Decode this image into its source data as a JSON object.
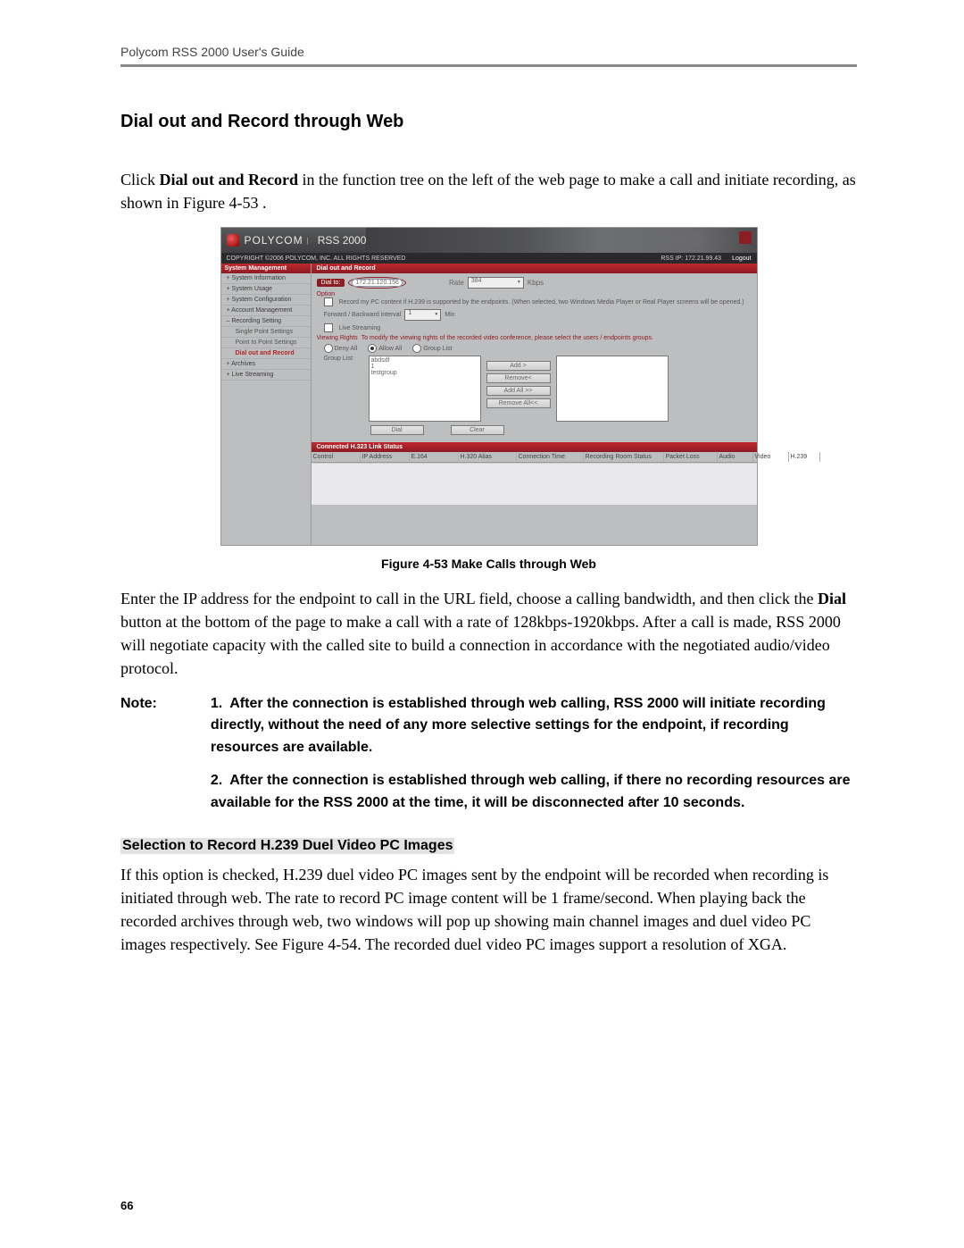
{
  "doc": {
    "running_head": "Polycom RSS 2000 User's Guide",
    "page_number": "66",
    "section_title": "Dial out and Record through Web",
    "intro_prefix": "Click ",
    "intro_bold": "Dial out and Record",
    "intro_suffix": " in the function tree on the left of the web page to make a call and initiate recording, as shown in Figure 4-53 .",
    "figure_caption": "Figure 4-53 Make Calls through Web",
    "para2_a": "Enter the IP address for the endpoint to call in the URL field, choose a calling bandwidth, and then click the ",
    "para2_bold": "Dial",
    "para2_b": " button at the bottom of the page to make a call with a rate of 128kbps-1920kbps. After a call is made, RSS 2000 will negotiate capacity with the called site to build a connection in accordance with the negotiated audio/video protocol.",
    "note_label": "Note:",
    "note1": "After the connection is established through web calling, RSS 2000 will initiate recording directly, without the need of any more selective settings for the endpoint, if recording resources are available.",
    "note2": "After the connection is established through web calling, if there no recording resources are available for the RSS 2000 at the time, it will be disconnected after 10 seconds.",
    "subsection": "Selection to Record H.239 Duel Video PC Images",
    "para3": "If this option is checked, H.239 duel video PC images sent by the endpoint will be recorded when recording is initiated through web. The rate to record PC image content will be 1 frame/second. When playing back the recorded archives through web, two windows will pop up showing main channel images and duel video PC images respectively. See Figure 4-54. The recorded duel video PC images support a resolution of XGA."
  },
  "app": {
    "brand_a": "POLYCOM",
    "brand_b": "RSS 2000",
    "copyright": "COPYRIGHT ©2006 POLYCOM, INC. ALL RIGHTS RESERVED",
    "rss_ip_label": "RSS IP: 172.21.99.43",
    "logout": "Logout",
    "sidebar_header": "System Management",
    "sidebar_items": [
      {
        "label": "System Information",
        "type": "expand"
      },
      {
        "label": "System Usage",
        "type": "expand"
      },
      {
        "label": "System Configuration",
        "type": "expand"
      },
      {
        "label": "Account Management",
        "type": "expand"
      },
      {
        "label": "Recording Setting",
        "type": "collapse"
      },
      {
        "label": "Single Point Settings",
        "type": "sub"
      },
      {
        "label": "Point to Point Settings",
        "type": "sub"
      },
      {
        "label": "Dial out and Record",
        "type": "sub-active"
      },
      {
        "label": "Archives",
        "type": "expand"
      },
      {
        "label": "Live Streaming",
        "type": "expand"
      }
    ],
    "content_header": "Dial out and Record",
    "dial_to_label": "Dial to:",
    "dial_to_value": "172.21.120.156",
    "rate_label": "Rate",
    "rate_value": "384",
    "rate_unit": "Kbps",
    "option_label": "Option",
    "record_pc_text": "Record my PC content if H.239 is supported by the endpoints. (When selected, two Windows Media Player or Real Player screens will be opened.)",
    "fwd_back_label": "Forward / Backward interval",
    "fwd_back_value": "1",
    "fwd_back_unit": "Min",
    "live_streaming_label": "Live Streaming",
    "viewing_rights_label": "Viewing Rights",
    "viewing_rights_hint": "To modify the viewing rights of the recorded video conference, please select the users / endpoints groups.",
    "radio_deny": "Deny All",
    "radio_allow": "Allow All",
    "radio_group": "Group List",
    "group_list_label": "Group List:",
    "group_list_items": [
      "abdsdf",
      "1",
      "testgroup"
    ],
    "btn_add": "Add >",
    "btn_remove": "Remove<",
    "btn_add_all": "Add All >>",
    "btn_remove_all": "Remove All<<",
    "btn_dial": "Dial",
    "btn_clear": "Clear",
    "status_header": "Connected H.323 Link Status",
    "cols": [
      "Control",
      "IP Address",
      "E.164",
      "H.320 Alias",
      "Connection Time",
      "Recording Room Status",
      "Packet Loss",
      "Audio",
      "Video",
      "H.239"
    ]
  }
}
